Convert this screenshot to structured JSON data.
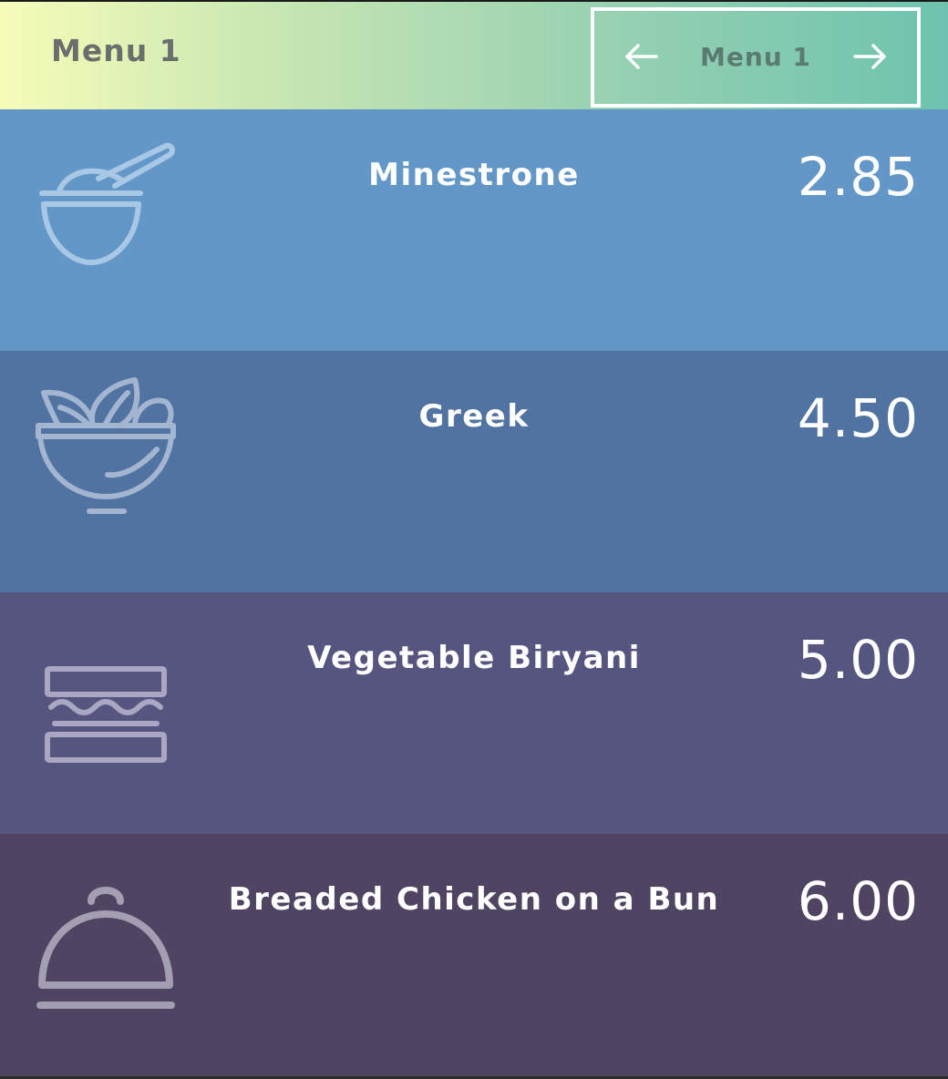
{
  "header": {
    "title": "Menu 1",
    "switcher": {
      "label": "Menu 1",
      "prev_icon": "arrow-left-icon",
      "next_icon": "arrow-right-icon"
    }
  },
  "items": [
    {
      "name": "Minestrone",
      "price": "2.85",
      "icon": "soup-bowl-icon"
    },
    {
      "name": "Greek",
      "price": "4.50",
      "icon": "salad-bowl-icon"
    },
    {
      "name": "Vegetable Biryani",
      "price": "5.00",
      "icon": "sandwich-icon"
    },
    {
      "name": "Breaded Chicken on a Bun",
      "price": "6.00",
      "icon": "cloche-icon"
    }
  ],
  "colors": {
    "header_gradient_start": "#f6fcb8",
    "header_gradient_end": "#6dc3ae",
    "row1": "#6297c8",
    "row2": "#5073a1",
    "row3": "#565580",
    "row4": "#4f4461"
  }
}
